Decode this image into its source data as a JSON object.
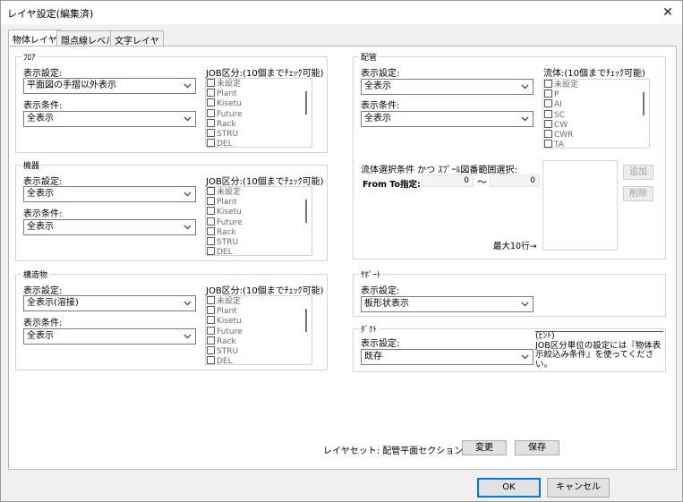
{
  "window": {
    "title": "レイヤ設定(編集済)",
    "close_glyph": "✕"
  },
  "tabs": [
    {
      "label": "物体レイヤ",
      "active": true
    },
    {
      "label": "隠点線レベル",
      "active": false
    },
    {
      "label": "文字レイヤ",
      "active": false
    }
  ],
  "floor": {
    "title": "ﾌﾛｱ",
    "display_setting_label": "表示設定:",
    "display_setting_value": "平面図の手摺以外表示",
    "display_condition_label": "表示条件:",
    "display_condition_value": "全表示",
    "job_label": "JOB区分:(10個までﾁｪｯｸ可能)",
    "job_items": [
      "未設定",
      "Plant",
      "Kisetu",
      "Future",
      "Rack",
      "STRU",
      "DEL"
    ]
  },
  "equipment": {
    "title": "機器",
    "display_setting_label": "表示設定:",
    "display_setting_value": "全表示",
    "display_condition_label": "表示条件:",
    "display_condition_value": "全表示",
    "job_label": "JOB区分:(10個までﾁｪｯｸ可能)",
    "job_items": [
      "未設定",
      "Plant",
      "Kisetu",
      "Future",
      "Rack",
      "STRU",
      "DEL"
    ]
  },
  "structure": {
    "title": "構造物",
    "display_setting_label": "表示設定:",
    "display_setting_value": "全表示(溶接)",
    "display_condition_label": "表示条件:",
    "display_condition_value": "全表示",
    "job_label": "JOB区分:(10個までﾁｪｯｸ可能)",
    "job_items": [
      "未設定",
      "Plant",
      "Kisetu",
      "Future",
      "Rack",
      "STRU",
      "DEL"
    ]
  },
  "piping": {
    "title": "配管",
    "display_setting_label": "表示設定:",
    "display_setting_value": "全表示",
    "display_condition_label": "表示条件:",
    "display_condition_value": "全表示",
    "fluid_label": "流体:(10個までﾁｪｯｸ可能)",
    "fluid_items": [
      "未設定",
      "P",
      "AI",
      "SC",
      "CW",
      "CWR",
      "TA"
    ],
    "spool_label": "流体選択条件 かつ ｽﾌﾟｰﾙ図番範囲選択:",
    "from_to_label": "From To指定:",
    "from_value": "0",
    "tilde": "～",
    "to_value": "0",
    "max_rows_label": "最大10行→",
    "add_button": "追加",
    "delete_button": "削除"
  },
  "support": {
    "title": "ｻﾎﾟｰﾄ",
    "display_setting_label": "表示設定:",
    "display_setting_value": "板形状表示"
  },
  "duct": {
    "title": "ﾀﾞｸﾄ",
    "display_setting_label": "表示設定:",
    "display_setting_value": "既存",
    "hint": "(ﾋﾝﾄ)\nJOB区分単位の設定には『物体表示絞込み条件』を使ってください。"
  },
  "layer_set": {
    "label": "レイヤセット: 配管平面セクション",
    "change_button": "変更",
    "save_button": "保存"
  },
  "footer": {
    "ok_button": "OK",
    "cancel_button": "キャンセル"
  },
  "colors": {
    "accent": "#0078d7",
    "disabled_text": "#a0a0a0"
  }
}
